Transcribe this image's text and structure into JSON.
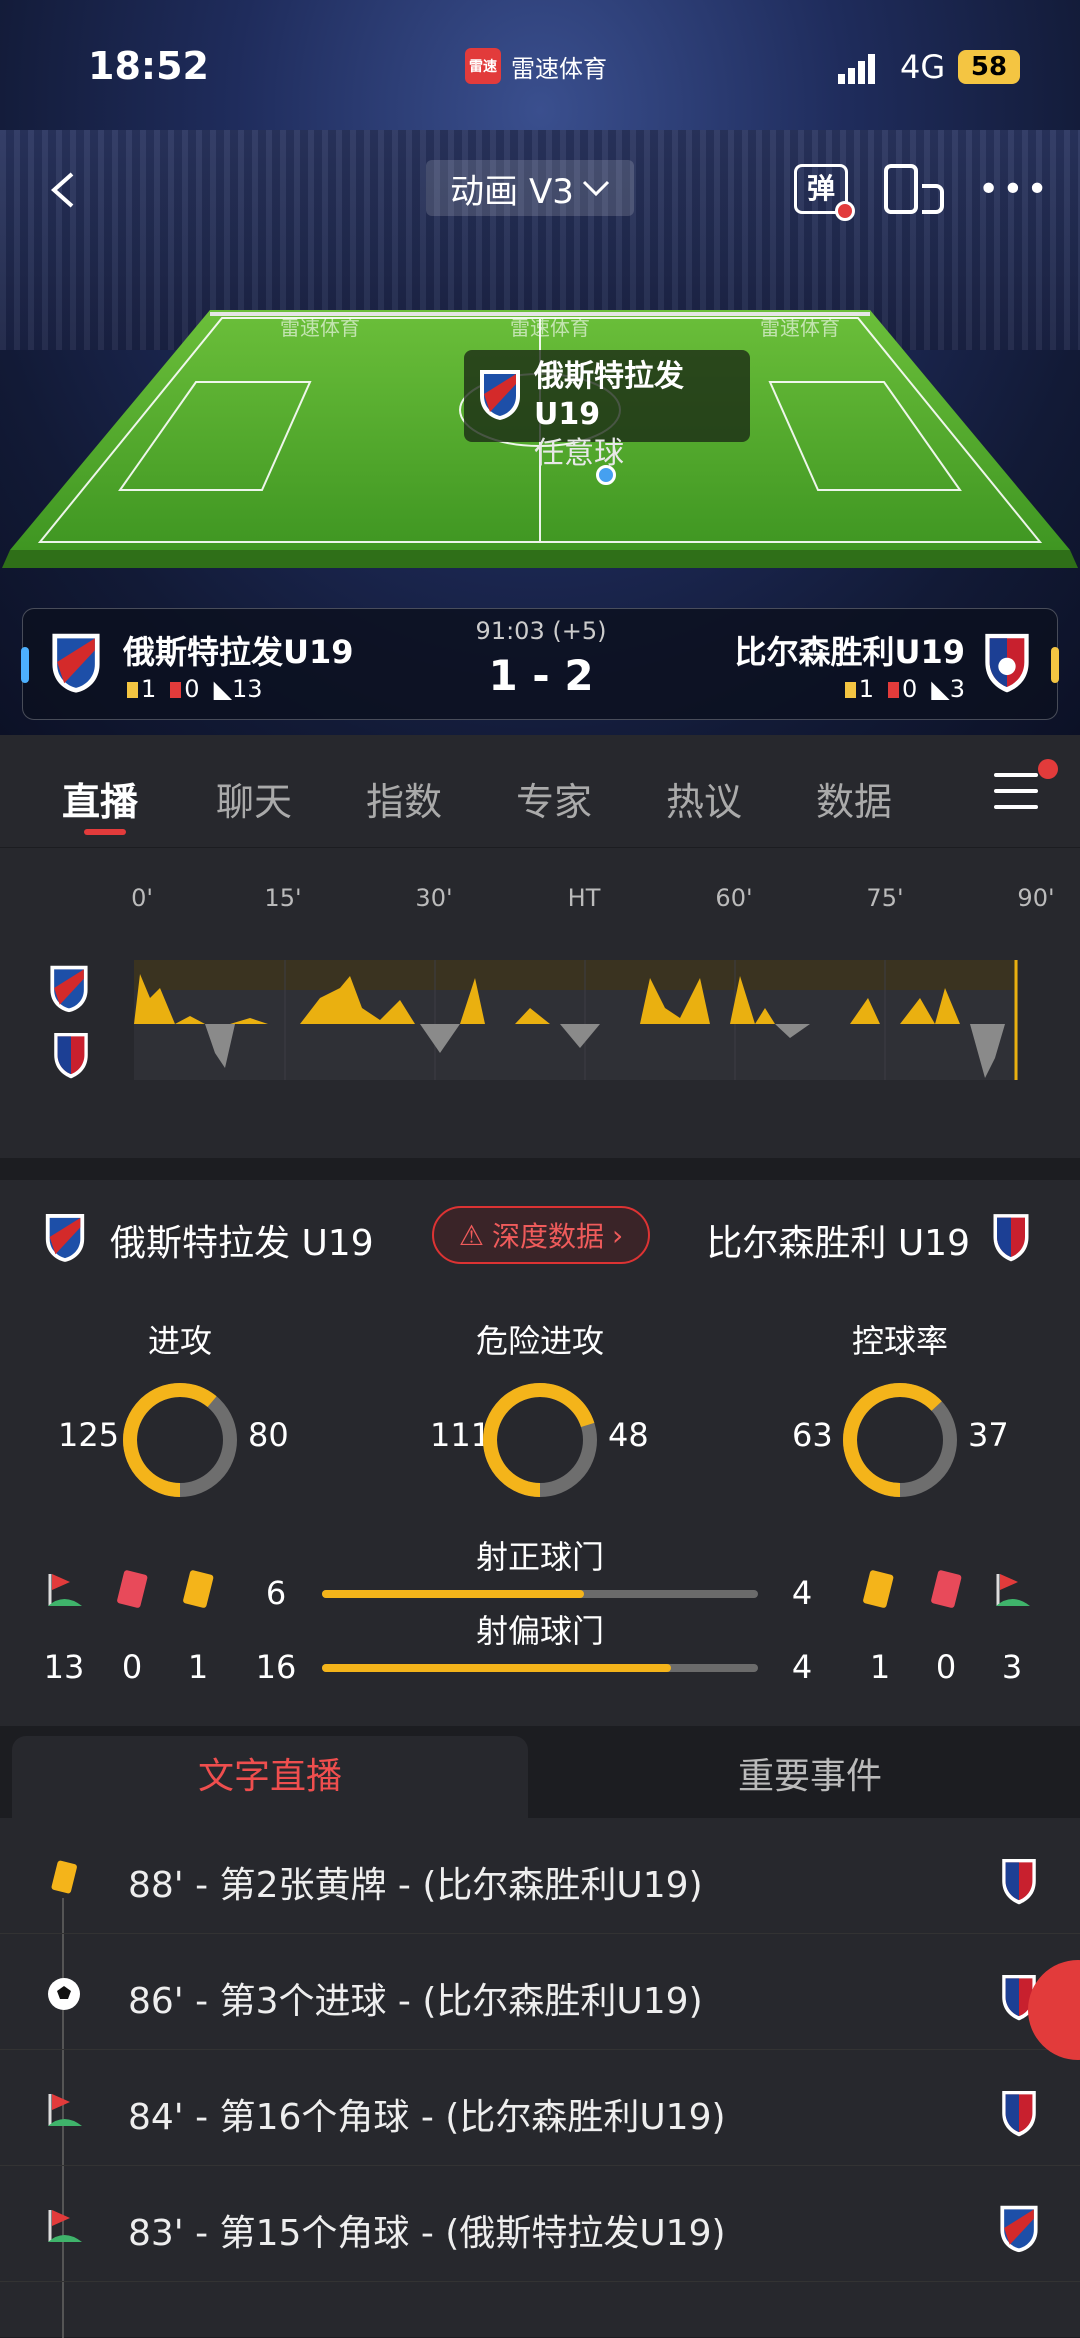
{
  "status_bar": {
    "time": "18:52",
    "brand": "雷速体育",
    "brand_short": "雷速",
    "network": "4G",
    "battery": "58"
  },
  "nav": {
    "mode_label": "动画 V3",
    "danmaku_label": "弹"
  },
  "animation": {
    "tooltip_team": "俄斯特拉发U19",
    "tooltip_event": "任意球",
    "watermark": "雷速体育"
  },
  "match": {
    "time": "91:03 (+5)",
    "score": "1 - 2",
    "home": {
      "name": "俄斯特拉发U19",
      "yellow": "1",
      "red": "0",
      "corners": "13"
    },
    "away": {
      "name": "比尔森胜利U19",
      "yellow": "1",
      "red": "0",
      "corners": "3"
    }
  },
  "tabs": [
    "直播",
    "聊天",
    "指数",
    "专家",
    "热议",
    "数据"
  ],
  "timeline": {
    "ticks": [
      "0'",
      "15'",
      "30'",
      "HT",
      "60'",
      "75'",
      "90'"
    ]
  },
  "stats": {
    "home_name": "俄斯特拉发 U19",
    "away_name": "比尔森胜利 U19",
    "deep_label": "深度数据",
    "rings": [
      {
        "title": "进攻",
        "home": "125",
        "away": "80",
        "home_share": 0.61
      },
      {
        "title": "危险进攻",
        "home": "111",
        "away": "48",
        "home_share": 0.7
      },
      {
        "title": "控球率",
        "home": "63",
        "away": "37",
        "home_share": 0.63
      }
    ],
    "bars": [
      {
        "title": "射正球门",
        "home": "6",
        "away": "4",
        "home_share": 0.6
      },
      {
        "title": "射偏球门",
        "home": "16",
        "away": "4",
        "home_share": 0.8
      }
    ],
    "home_counts": {
      "corners": "13",
      "red": "0",
      "yellow": "1"
    },
    "away_counts": {
      "yellow": "1",
      "red": "0",
      "corners": "3"
    }
  },
  "live_tabs": {
    "active": "文字直播",
    "other": "重要事件"
  },
  "feed": [
    {
      "text": "88' - 第2张黄牌 - (比尔森胜利U19)",
      "icon": "yellow-card-icon",
      "team": "away"
    },
    {
      "text": "86' - 第3个进球 - (比尔森胜利U19)",
      "icon": "football-icon",
      "team": "away"
    },
    {
      "text": "84' - 第16个角球 - (比尔森胜利U19)",
      "icon": "corner-flag-icon",
      "team": "away"
    },
    {
      "text": "83' - 第15个角球 - (俄斯特拉发U19)",
      "icon": "corner-flag-icon",
      "team": "home"
    }
  ],
  "colors": {
    "accent": "#e23b3b",
    "gold": "#f4b41a",
    "home_bar": "#4db0ff",
    "away_bar": "#f4c542"
  }
}
